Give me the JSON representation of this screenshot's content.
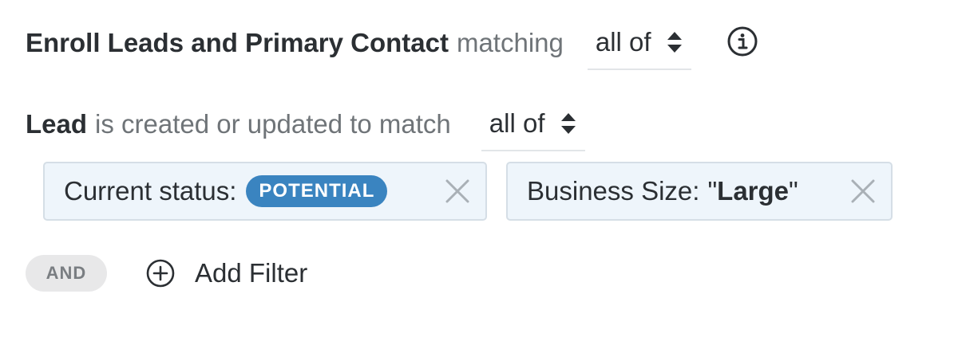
{
  "enroll": {
    "title": "Enroll Leads and Primary Contact",
    "matching": "matching",
    "select_value": "all of",
    "info_icon": "info-icon"
  },
  "lead": {
    "title": "Lead",
    "text": "is created or updated to match",
    "select_value": "all of"
  },
  "filters": [
    {
      "label": "Current status:",
      "badge": "POTENTIAL",
      "badge_color": "#3a84c0"
    },
    {
      "label": "Business Size:",
      "quote_open": "\"",
      "value": "Large",
      "quote_close": "\""
    }
  ],
  "footer": {
    "and_label": "AND",
    "add_filter_label": "Add Filter"
  }
}
